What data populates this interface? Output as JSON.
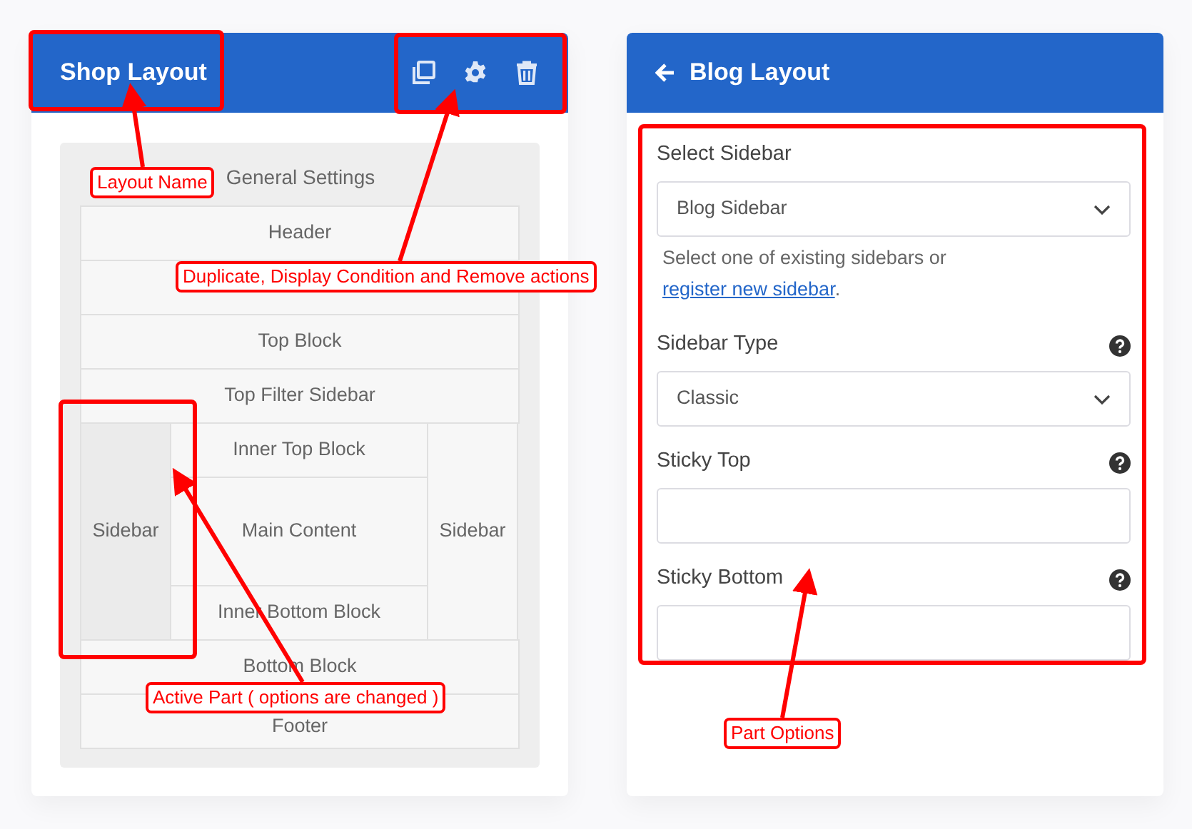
{
  "shop_panel": {
    "title": "Shop Layout",
    "actions": [
      {
        "kind": "duplicate"
      },
      {
        "kind": "settings"
      },
      {
        "kind": "delete"
      }
    ],
    "preview": {
      "title": "General Settings",
      "rows": [
        {
          "kind": "part",
          "label": "Header",
          "active": false
        },
        {
          "kind": "part",
          "active": false
        },
        {
          "kind": "part",
          "label": "Top Block",
          "active": false
        },
        {
          "kind": "part",
          "label": "Top Filter Sidebar",
          "active": false
        },
        {
          "kind": "columns",
          "left": {
            "label": "Sidebar",
            "active": true
          },
          "center": [
            {
              "label": "Inner Top Block",
              "active": false
            },
            {
              "label": "Main Content",
              "main": true,
              "active": false
            },
            {
              "label": "Inner Bottom Block",
              "active": false
            }
          ],
          "right": {
            "label": "Sidebar",
            "active": false
          }
        },
        {
          "kind": "part",
          "label": "Bottom Block",
          "active": false
        },
        {
          "kind": "part",
          "label": "Footer",
          "active": false
        }
      ]
    }
  },
  "blog_panel": {
    "title": "Blog Layout",
    "fields": [
      {
        "kind": "select",
        "label": "Select Sidebar",
        "value": "Blog Sidebar",
        "help_icon": false,
        "help": {
          "text": "Select one of existing sidebars or ",
          "link": "register new sidebar",
          "after": "."
        }
      },
      {
        "kind": "select",
        "label": "Sidebar Type",
        "value": "Classic",
        "help_icon": true
      },
      {
        "kind": "input",
        "label": "Sticky Top",
        "help_icon": true
      },
      {
        "kind": "input",
        "label": "Sticky Bottom",
        "help_icon": true
      }
    ]
  },
  "annotations": [
    {
      "label": "Layout Name"
    },
    {
      "label": "Duplicate, Display Condition and Remove actions"
    },
    {
      "label": "Active Part ( options are changed )"
    },
    {
      "label": "Part Options"
    }
  ]
}
